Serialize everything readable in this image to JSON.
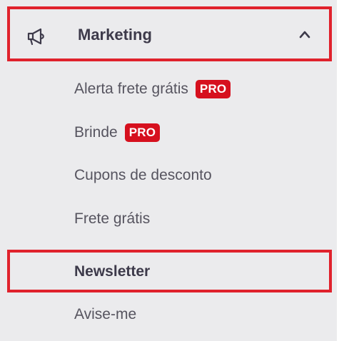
{
  "menu": {
    "title": "Marketing",
    "icon": "megaphone-icon",
    "expanded": true,
    "items": [
      {
        "label": "Alerta frete grátis",
        "badge": "PRO"
      },
      {
        "label": "Brinde",
        "badge": "PRO"
      },
      {
        "label": "Cupons de desconto"
      },
      {
        "label": "Frete grátis"
      },
      {
        "label": "Newsletter",
        "active": true
      },
      {
        "label": "Avise-me"
      }
    ]
  },
  "colors": {
    "highlight_border": "#e0222c",
    "badge_bg": "#d6101e",
    "panel_bg": "#ebebed",
    "text": "#56545f",
    "active_text": "#3d3a4a"
  }
}
